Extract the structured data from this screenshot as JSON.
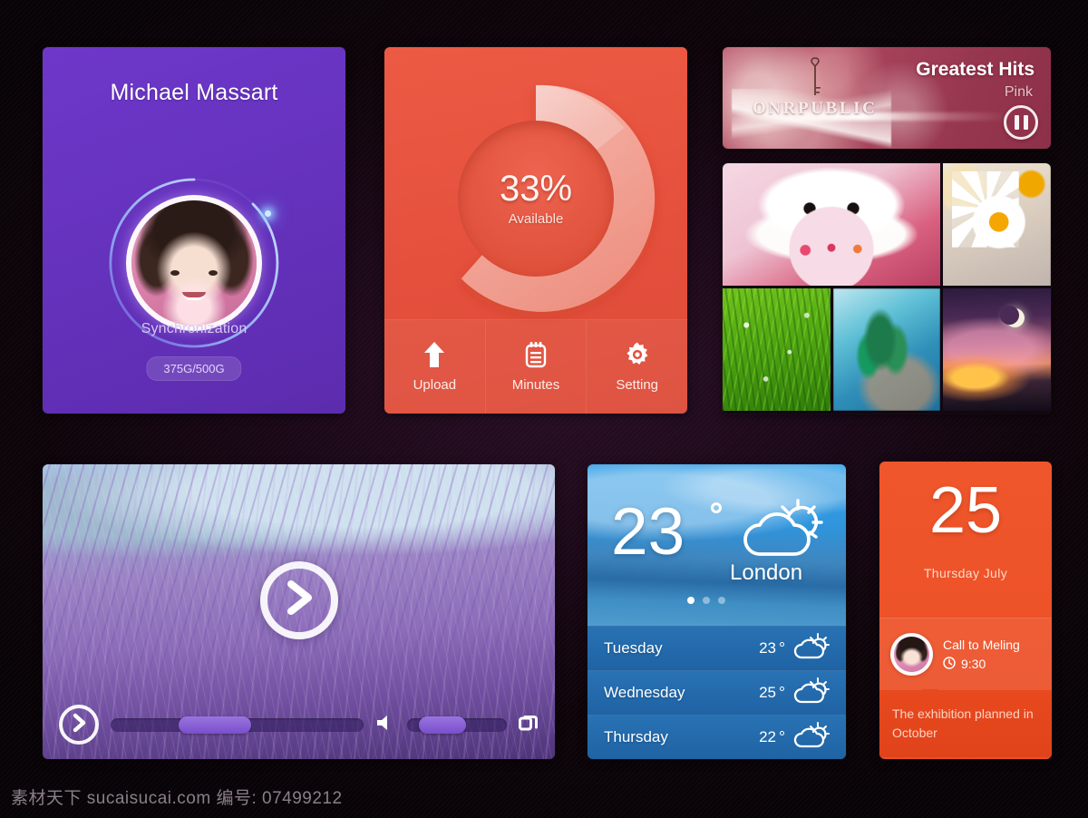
{
  "profile": {
    "name": "Michael Massart",
    "status_label": "Synchronization",
    "quota": "375G/500G",
    "avatar_icon": "user-avatar",
    "accent": "#6633bf"
  },
  "storage": {
    "percent_text": "33%",
    "available_label": "Available",
    "accent": "#e4503c",
    "actions": [
      {
        "label": "Upload",
        "icon": "upload-arrow-icon"
      },
      {
        "label": "Minutes",
        "icon": "notepad-icon"
      },
      {
        "label": "Setting",
        "icon": "gear-icon"
      }
    ]
  },
  "music": {
    "title": "Greatest Hits",
    "artist": "Pink",
    "watermark": "ONRPUBLIC",
    "transport_icon": "pause-icon"
  },
  "gallery": {
    "photos": [
      {
        "name": "white-puppy-in-cup"
      },
      {
        "name": "dewy-green-grass"
      },
      {
        "name": "white-daisy-flower"
      },
      {
        "name": "blue-teal-plant"
      },
      {
        "name": "crescent-moon-sunset"
      },
      {
        "name": "lavender-field"
      }
    ]
  },
  "video": {
    "play_icon": "play-chevron-icon",
    "volume_icon": "speaker-icon",
    "fullscreen_icon": "fullscreen-icon",
    "progress_percent": "30",
    "volume_percent": "45"
  },
  "weather": {
    "temperature": "23",
    "city": "London",
    "condition_icon": "partly-cloudy-icon",
    "page_dots": 3,
    "active_dot": 1,
    "forecast": [
      {
        "day": "Tuesday",
        "temp": "23",
        "icon": "partly-cloudy-icon"
      },
      {
        "day": "Wednesday",
        "temp": "25",
        "icon": "partly-cloudy-icon"
      },
      {
        "day": "Thursday",
        "temp": "22",
        "icon": "partly-cloudy-icon"
      }
    ]
  },
  "calendar": {
    "day_number": "25",
    "weekday_month": "Thursday  July",
    "event_title": "Call to Meling",
    "event_time": "9:30",
    "event_time_icon": "clock-icon",
    "note": "The exhibition planned in October",
    "accent": "#ea4f26"
  },
  "footer": {
    "watermark": "素材天下 sucaisucai.com  编号: 07499212"
  }
}
